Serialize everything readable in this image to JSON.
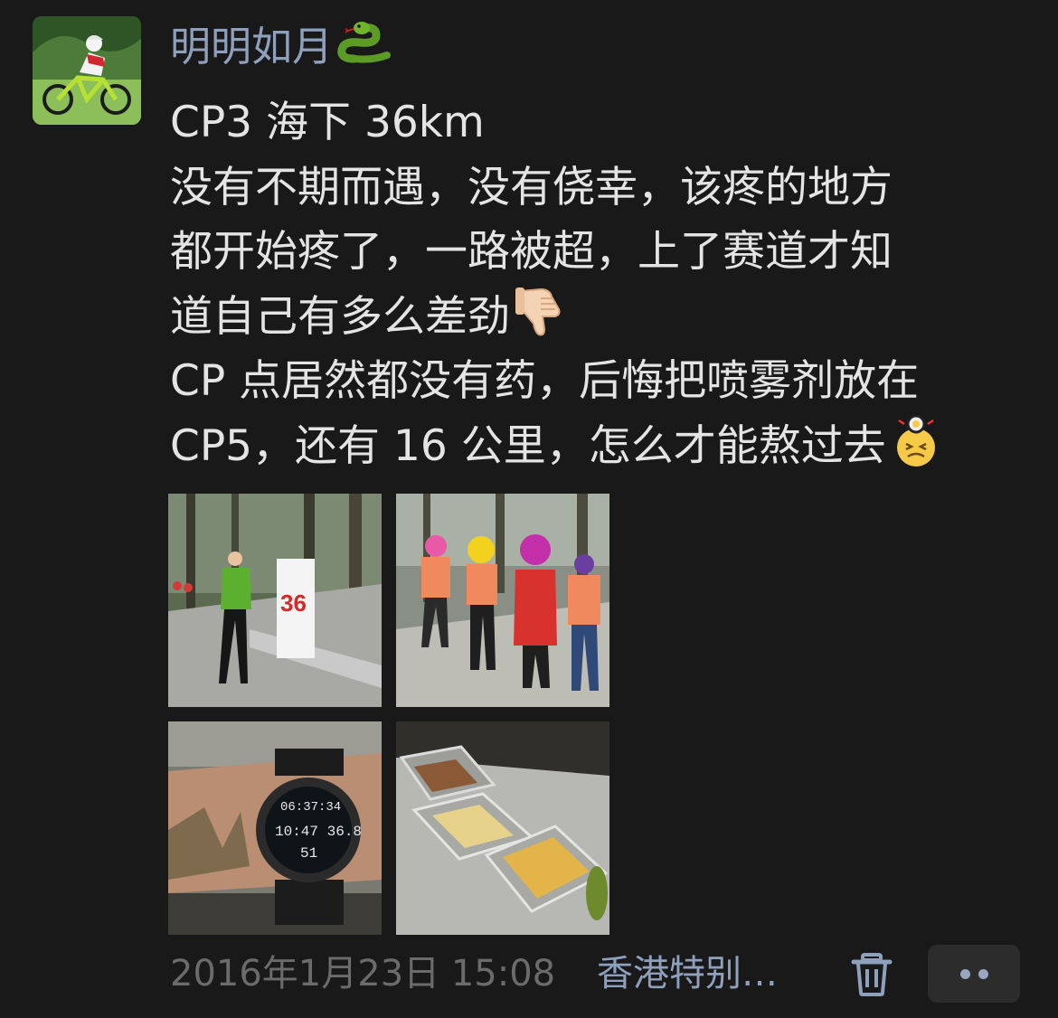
{
  "post": {
    "author": "明明如月",
    "author_emoji": "snake-emoji",
    "text_lines": [
      "CP3 海下 36km",
      "没有不期而遇，没有侥幸，该疼的地方",
      "都开始疼了，一路被超，上了赛道才知",
      "道自己有多么差劲",
      "CP 点居然都没有药，后悔把喷雾剂放在",
      "CP5，还有 16 公里，怎么才能熬过去"
    ],
    "inline_emojis": [
      "thumbs-down-emoji",
      "dizzy-grimace-emoji"
    ],
    "photos": [
      {
        "name": "hiker-at-36km-sign",
        "sign_text": "36"
      },
      {
        "name": "volunteers-in-wigs"
      },
      {
        "name": "muddy-arm-sport-watch",
        "watch_lines": [
          "06:37:34",
          "10:47  36.8",
          "51"
        ]
      },
      {
        "name": "food-trays"
      }
    ],
    "timestamp": "2016年1月23日 15:08",
    "location": "香港特别…",
    "delete_icon": "trash-icon",
    "more_icon": "more-dots-icon"
  },
  "colors": {
    "background": "#191919",
    "author_name": "#8fa0bd",
    "body_text": "#e4e4e4",
    "timestamp": "#6b6b6b",
    "location": "#8fa0bd"
  }
}
